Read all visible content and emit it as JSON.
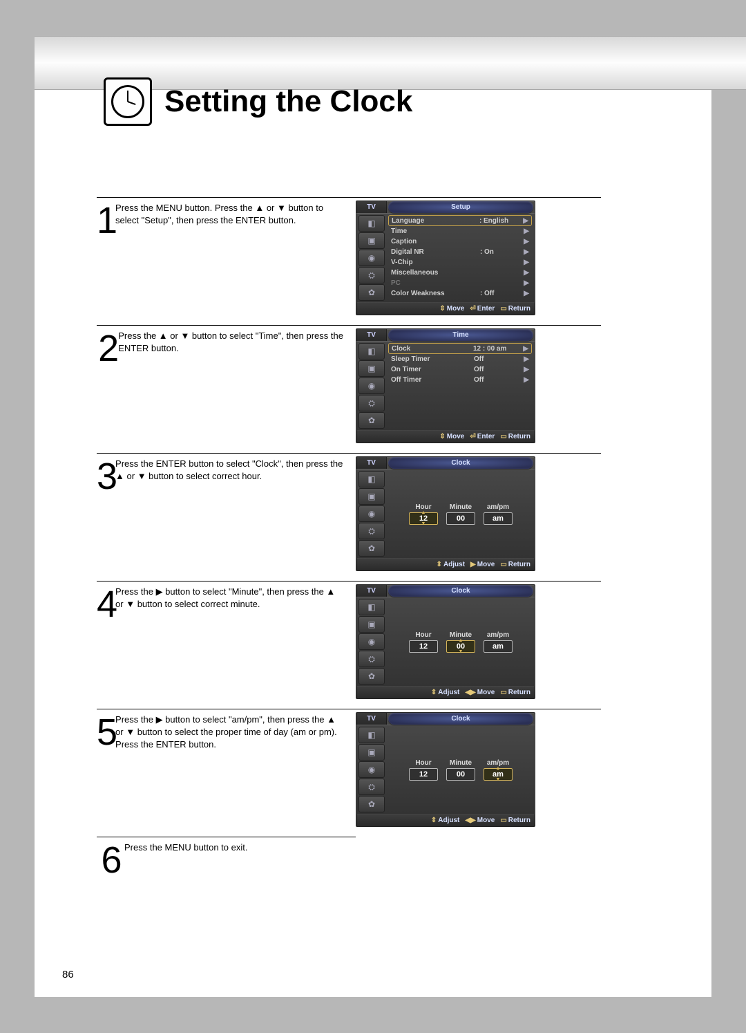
{
  "page_title": "Setting the Clock",
  "page_number": "86",
  "steps": {
    "1": "Press the MENU button. Press the ▲ or ▼ button to select \"Setup\", then press the ENTER button.",
    "2": "Press the ▲ or ▼ button to select \"Time\", then press the ENTER button.",
    "3": "Press the ENTER button to select \"Clock\", then press the ▲ or ▼ button to select correct hour.",
    "4": "Press the ▶ button to select \"Minute\", then press the ▲ or ▼ button to select correct minute.",
    "5": "Press the ▶ button to select \"am/pm\", then press the ▲ or ▼ button to select the proper time of day (am or pm).\nPress the ENTER button.",
    "6": "Press the MENU button to exit."
  },
  "osd_common": {
    "tv": "TV",
    "hints": {
      "move_ud": "Move",
      "enter": "Enter",
      "return": "Return",
      "adjust": "Adjust",
      "move_r": "Move",
      "move_lr": "Move"
    }
  },
  "osd1": {
    "title": "Setup",
    "rows": [
      {
        "label": "Language",
        "value": "English",
        "dim": false,
        "sel": true
      },
      {
        "label": "Time",
        "value": "",
        "dim": false
      },
      {
        "label": "Caption",
        "value": "",
        "dim": false
      },
      {
        "label": "Digital NR",
        "value": "On",
        "dim": false
      },
      {
        "label": "V-Chip",
        "value": "",
        "dim": false
      },
      {
        "label": "Miscellaneous",
        "value": "",
        "dim": false
      },
      {
        "label": "PC",
        "value": "",
        "dim": true
      },
      {
        "label": "Color Weakness",
        "value": "Off",
        "dim": false
      }
    ]
  },
  "osd2": {
    "title": "Time",
    "rows": [
      {
        "label": "Clock",
        "value": "12 : 00 am",
        "sel": true
      },
      {
        "label": "Sleep Timer",
        "value": "Off"
      },
      {
        "label": "On Timer",
        "value": "Off"
      },
      {
        "label": "Off Timer",
        "value": "Off"
      }
    ]
  },
  "clock_panel": {
    "title": "Clock",
    "labels": {
      "hour": "Hour",
      "minute": "Minute",
      "ampm": "am/pm"
    },
    "values": {
      "hour": "12",
      "minute": "00",
      "ampm": "am"
    }
  }
}
